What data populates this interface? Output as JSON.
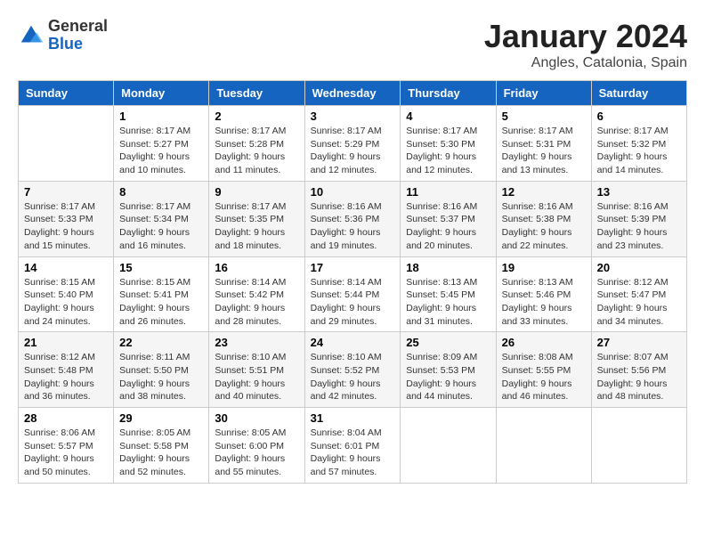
{
  "header": {
    "logo": {
      "general": "General",
      "blue": "Blue"
    },
    "title": "January 2024",
    "subtitle": "Angles, Catalonia, Spain"
  },
  "weekdays": [
    "Sunday",
    "Monday",
    "Tuesday",
    "Wednesday",
    "Thursday",
    "Friday",
    "Saturday"
  ],
  "weeks": [
    [
      {
        "day": "",
        "info": ""
      },
      {
        "day": "1",
        "info": "Sunrise: 8:17 AM\nSunset: 5:27 PM\nDaylight: 9 hours\nand 10 minutes."
      },
      {
        "day": "2",
        "info": "Sunrise: 8:17 AM\nSunset: 5:28 PM\nDaylight: 9 hours\nand 11 minutes."
      },
      {
        "day": "3",
        "info": "Sunrise: 8:17 AM\nSunset: 5:29 PM\nDaylight: 9 hours\nand 12 minutes."
      },
      {
        "day": "4",
        "info": "Sunrise: 8:17 AM\nSunset: 5:30 PM\nDaylight: 9 hours\nand 12 minutes."
      },
      {
        "day": "5",
        "info": "Sunrise: 8:17 AM\nSunset: 5:31 PM\nDaylight: 9 hours\nand 13 minutes."
      },
      {
        "day": "6",
        "info": "Sunrise: 8:17 AM\nSunset: 5:32 PM\nDaylight: 9 hours\nand 14 minutes."
      }
    ],
    [
      {
        "day": "7",
        "info": "Sunrise: 8:17 AM\nSunset: 5:33 PM\nDaylight: 9 hours\nand 15 minutes."
      },
      {
        "day": "8",
        "info": "Sunrise: 8:17 AM\nSunset: 5:34 PM\nDaylight: 9 hours\nand 16 minutes."
      },
      {
        "day": "9",
        "info": "Sunrise: 8:17 AM\nSunset: 5:35 PM\nDaylight: 9 hours\nand 18 minutes."
      },
      {
        "day": "10",
        "info": "Sunrise: 8:16 AM\nSunset: 5:36 PM\nDaylight: 9 hours\nand 19 minutes."
      },
      {
        "day": "11",
        "info": "Sunrise: 8:16 AM\nSunset: 5:37 PM\nDaylight: 9 hours\nand 20 minutes."
      },
      {
        "day": "12",
        "info": "Sunrise: 8:16 AM\nSunset: 5:38 PM\nDaylight: 9 hours\nand 22 minutes."
      },
      {
        "day": "13",
        "info": "Sunrise: 8:16 AM\nSunset: 5:39 PM\nDaylight: 9 hours\nand 23 minutes."
      }
    ],
    [
      {
        "day": "14",
        "info": "Sunrise: 8:15 AM\nSunset: 5:40 PM\nDaylight: 9 hours\nand 24 minutes."
      },
      {
        "day": "15",
        "info": "Sunrise: 8:15 AM\nSunset: 5:41 PM\nDaylight: 9 hours\nand 26 minutes."
      },
      {
        "day": "16",
        "info": "Sunrise: 8:14 AM\nSunset: 5:42 PM\nDaylight: 9 hours\nand 28 minutes."
      },
      {
        "day": "17",
        "info": "Sunrise: 8:14 AM\nSunset: 5:44 PM\nDaylight: 9 hours\nand 29 minutes."
      },
      {
        "day": "18",
        "info": "Sunrise: 8:13 AM\nSunset: 5:45 PM\nDaylight: 9 hours\nand 31 minutes."
      },
      {
        "day": "19",
        "info": "Sunrise: 8:13 AM\nSunset: 5:46 PM\nDaylight: 9 hours\nand 33 minutes."
      },
      {
        "day": "20",
        "info": "Sunrise: 8:12 AM\nSunset: 5:47 PM\nDaylight: 9 hours\nand 34 minutes."
      }
    ],
    [
      {
        "day": "21",
        "info": "Sunrise: 8:12 AM\nSunset: 5:48 PM\nDaylight: 9 hours\nand 36 minutes."
      },
      {
        "day": "22",
        "info": "Sunrise: 8:11 AM\nSunset: 5:50 PM\nDaylight: 9 hours\nand 38 minutes."
      },
      {
        "day": "23",
        "info": "Sunrise: 8:10 AM\nSunset: 5:51 PM\nDaylight: 9 hours\nand 40 minutes."
      },
      {
        "day": "24",
        "info": "Sunrise: 8:10 AM\nSunset: 5:52 PM\nDaylight: 9 hours\nand 42 minutes."
      },
      {
        "day": "25",
        "info": "Sunrise: 8:09 AM\nSunset: 5:53 PM\nDaylight: 9 hours\nand 44 minutes."
      },
      {
        "day": "26",
        "info": "Sunrise: 8:08 AM\nSunset: 5:55 PM\nDaylight: 9 hours\nand 46 minutes."
      },
      {
        "day": "27",
        "info": "Sunrise: 8:07 AM\nSunset: 5:56 PM\nDaylight: 9 hours\nand 48 minutes."
      }
    ],
    [
      {
        "day": "28",
        "info": "Sunrise: 8:06 AM\nSunset: 5:57 PM\nDaylight: 9 hours\nand 50 minutes."
      },
      {
        "day": "29",
        "info": "Sunrise: 8:05 AM\nSunset: 5:58 PM\nDaylight: 9 hours\nand 52 minutes."
      },
      {
        "day": "30",
        "info": "Sunrise: 8:05 AM\nSunset: 6:00 PM\nDaylight: 9 hours\nand 55 minutes."
      },
      {
        "day": "31",
        "info": "Sunrise: 8:04 AM\nSunset: 6:01 PM\nDaylight: 9 hours\nand 57 minutes."
      },
      {
        "day": "",
        "info": ""
      },
      {
        "day": "",
        "info": ""
      },
      {
        "day": "",
        "info": ""
      }
    ]
  ]
}
